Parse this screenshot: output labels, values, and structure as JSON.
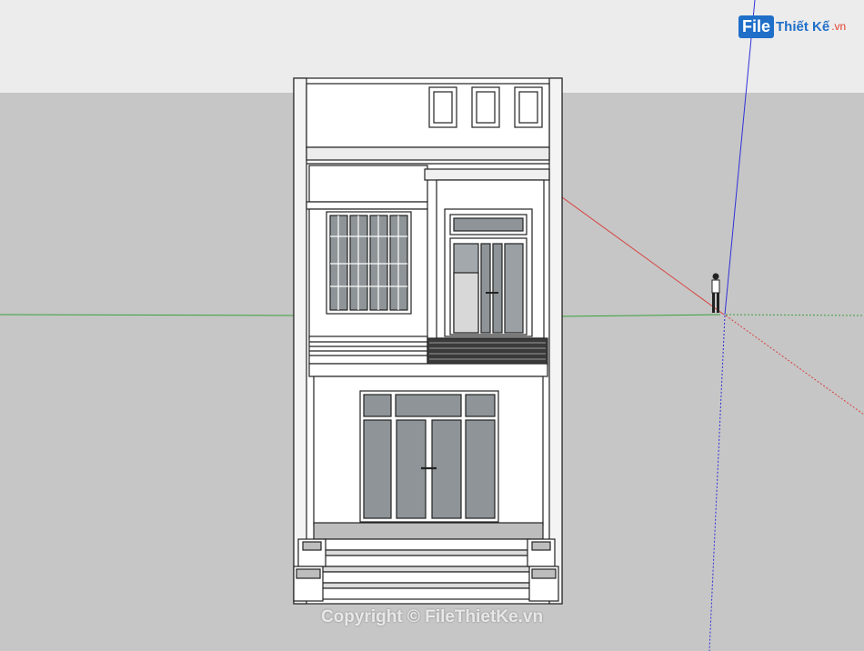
{
  "logo": {
    "box": "File",
    "text": "Thiết Kế",
    "suffix": ".vn"
  },
  "watermark": "Copyright © FileThietKe.vn",
  "colors": {
    "sky": "#ececec",
    "ground": "#c6c6c6",
    "axis_green": "#3aa13a",
    "axis_red": "#d84040",
    "axis_blue": "#3030d8",
    "wall": "#ffffff",
    "outline": "#222222",
    "glass": "#8e9497",
    "brand": "#1f6fc9"
  },
  "icons": {
    "figure": "person-scale-figure-icon"
  }
}
